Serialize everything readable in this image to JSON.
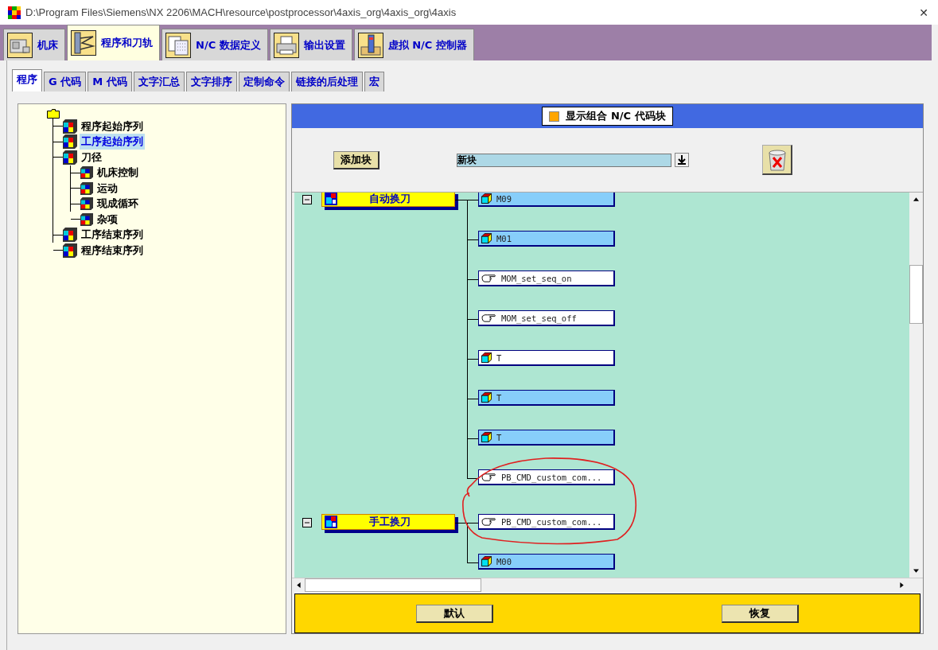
{
  "window": {
    "title": "D:\\Program Files\\Siemens\\NX 2206\\MACH\\resource\\postprocessor\\4axis_org\\4axis_org\\4axis",
    "close": "✕"
  },
  "main_tabs": [
    {
      "label": "机床",
      "selected": false
    },
    {
      "label": "程序和刀轨",
      "selected": true
    },
    {
      "label": "N/C 数据定义",
      "selected": false
    },
    {
      "label": "输出设置",
      "selected": false
    },
    {
      "label": "虚拟 N/C 控制器",
      "selected": false
    }
  ],
  "sub_tabs": [
    {
      "label": "程序",
      "selected": true
    },
    {
      "label": "G 代码",
      "selected": false
    },
    {
      "label": "M 代码",
      "selected": false
    },
    {
      "label": "文字汇总",
      "selected": false
    },
    {
      "label": "文字排序",
      "selected": false
    },
    {
      "label": "定制命令",
      "selected": false
    },
    {
      "label": "链接的后处理",
      "selected": false
    },
    {
      "label": "宏",
      "selected": false
    }
  ],
  "tree": {
    "children": [
      {
        "label": "程序起始序列",
        "selected": false
      },
      {
        "label": "工序起始序列",
        "selected": true
      },
      {
        "label": "刀径",
        "selected": false,
        "children": [
          {
            "label": "机床控制",
            "selected": false
          },
          {
            "label": "运动",
            "selected": false
          },
          {
            "label": "现成循环",
            "selected": false
          },
          {
            "label": "杂项",
            "selected": false
          }
        ]
      },
      {
        "label": "工序结束序列",
        "selected": false
      },
      {
        "label": "程序结束序列",
        "selected": false
      }
    ]
  },
  "header": {
    "checkbox_label": "显示组合 N/C 代码块",
    "checked": false
  },
  "toolbar": {
    "add_button": "添加块",
    "dropdown_value": "新块"
  },
  "groups": [
    {
      "label": "自动换刀",
      "expanded": true,
      "blocks": [
        {
          "label": "M09",
          "kind": "block",
          "highlighted": true
        },
        {
          "label": "M01",
          "kind": "block",
          "highlighted": true
        },
        {
          "label": "MOM_set_seq_on",
          "kind": "command",
          "highlighted": false
        },
        {
          "label": "MOM_set_seq_off",
          "kind": "command",
          "highlighted": false
        },
        {
          "label": "T",
          "kind": "block",
          "highlighted": false
        },
        {
          "label": "T",
          "kind": "block",
          "highlighted": true
        },
        {
          "label": "T",
          "kind": "block",
          "highlighted": true
        },
        {
          "label": "PB_CMD_custom_com...",
          "kind": "command",
          "highlighted": false
        }
      ]
    },
    {
      "label": "手工换刀",
      "expanded": true,
      "blocks": [
        {
          "label": "PB_CMD_custom_com...",
          "kind": "command",
          "highlighted": false
        },
        {
          "label": "M00",
          "kind": "block",
          "highlighted": true
        }
      ]
    }
  ],
  "buttons": [
    "默认",
    "恢复"
  ]
}
